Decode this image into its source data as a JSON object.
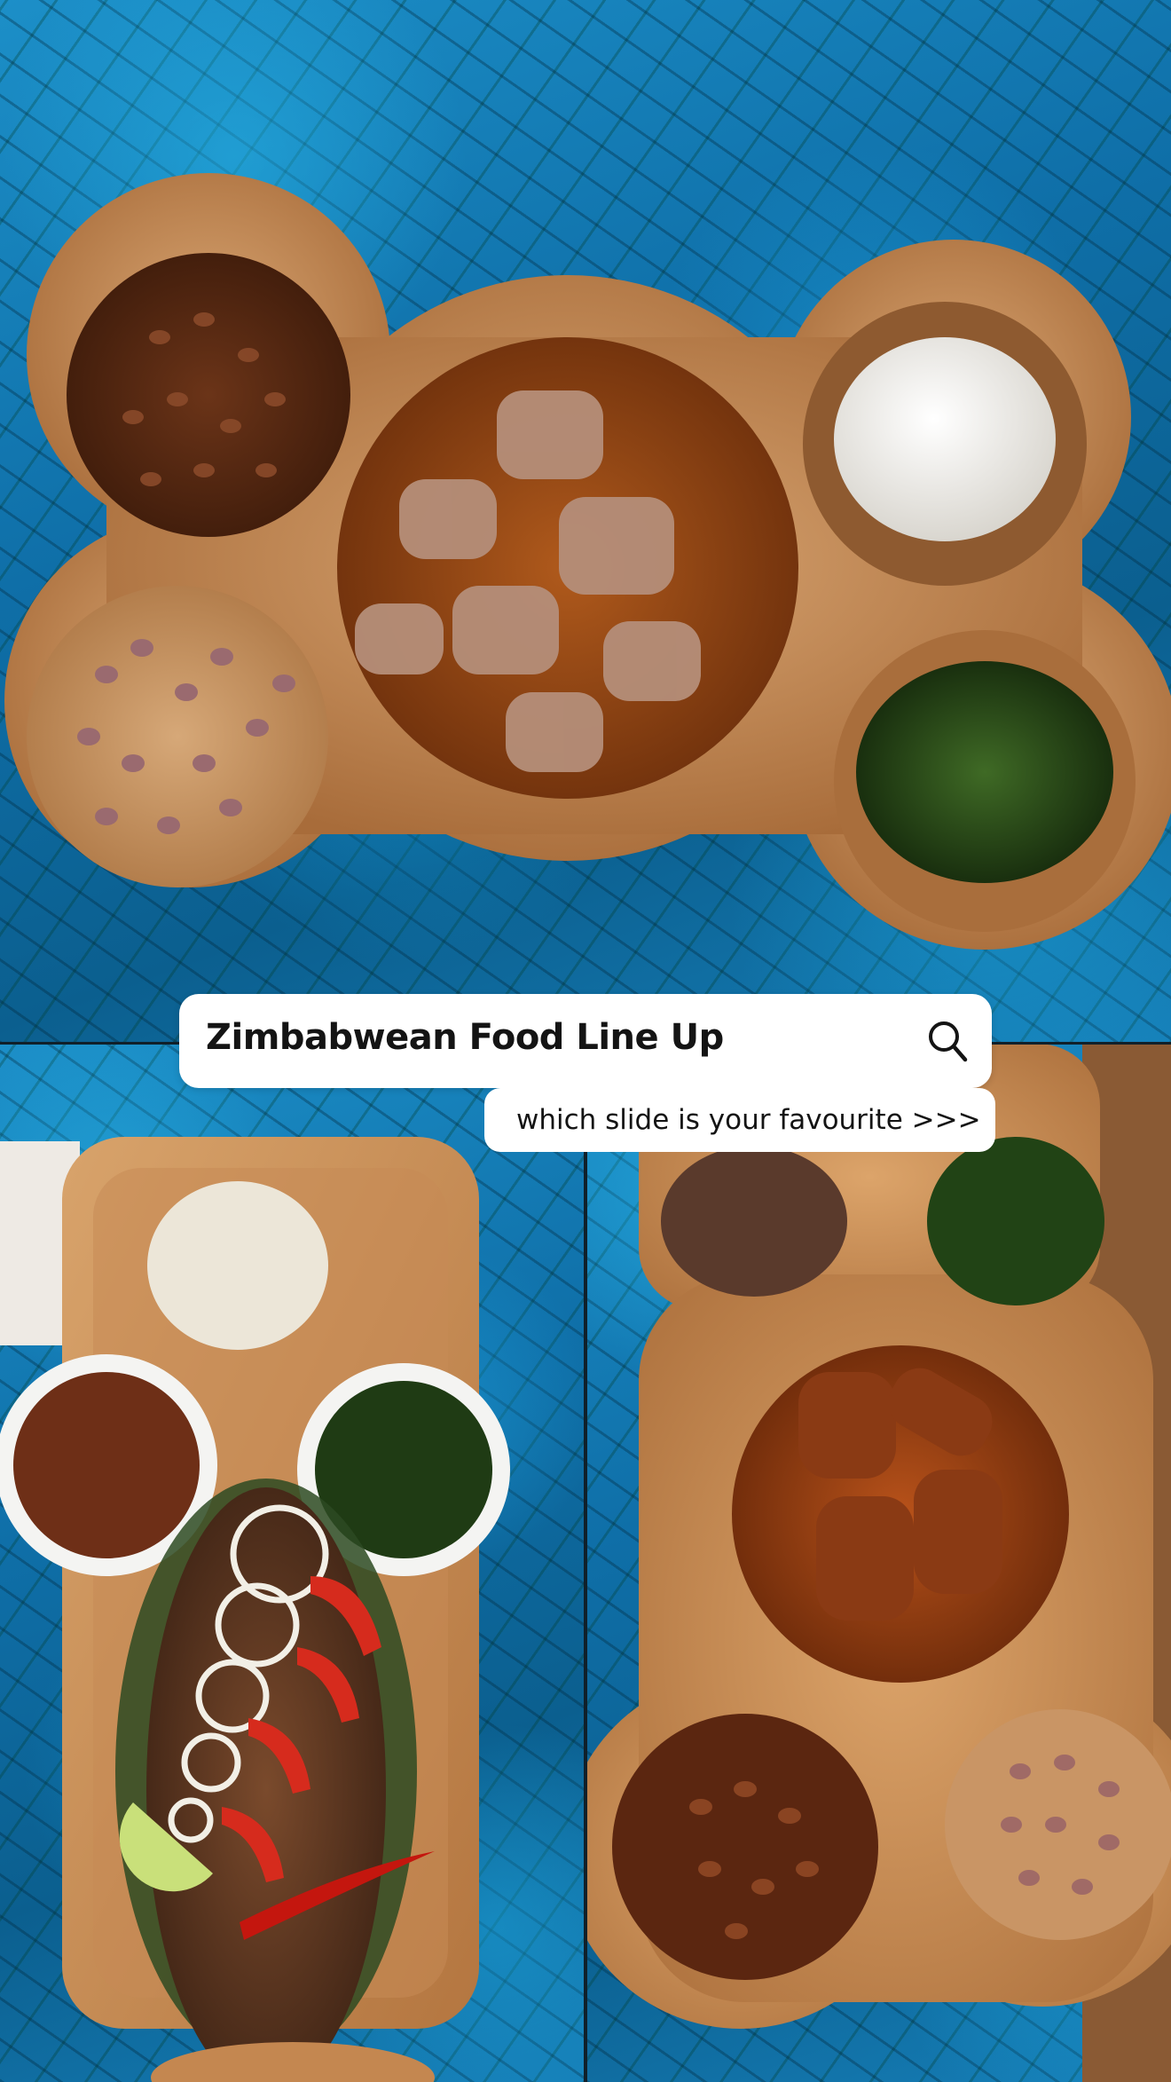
{
  "search": {
    "title": "Zimbabwean Food Line Up",
    "icon": "search-icon"
  },
  "caption": {
    "text": "which slide is your favourite >>>"
  },
  "colors": {
    "fabric_blue": "#1c8fc8",
    "wood": "#c98f58",
    "bubble": "#ffffff",
    "text": "#141414"
  }
}
